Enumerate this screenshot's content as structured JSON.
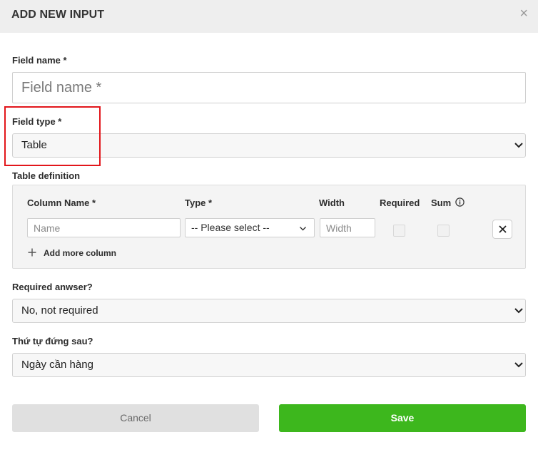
{
  "modal": {
    "title": "ADD NEW INPUT",
    "close_icon": "close-icon"
  },
  "field_name": {
    "label": "Field name *",
    "placeholder": "Field name *",
    "value": ""
  },
  "field_type": {
    "label": "Field type *",
    "selected": "Table",
    "highlight_color": "#e2161b"
  },
  "table_definition": {
    "label": "Table definition",
    "headers": {
      "column_name": "Column Name *",
      "type": "Type *",
      "width": "Width",
      "required": "Required",
      "sum": "Sum"
    },
    "row": {
      "name_placeholder": "Name",
      "type_selected": "-- Please select --",
      "width_placeholder": "Width",
      "required_checked": false,
      "sum_checked": false
    },
    "add_more_label": "Add more column"
  },
  "required_answer": {
    "label": "Required anwser?",
    "selected": "No, not required"
  },
  "order_after": {
    "label": "Thứ tự đứng sau?",
    "selected": "Ngày cần hàng"
  },
  "buttons": {
    "cancel": "Cancel",
    "save": "Save",
    "save_color": "#3db71d"
  }
}
